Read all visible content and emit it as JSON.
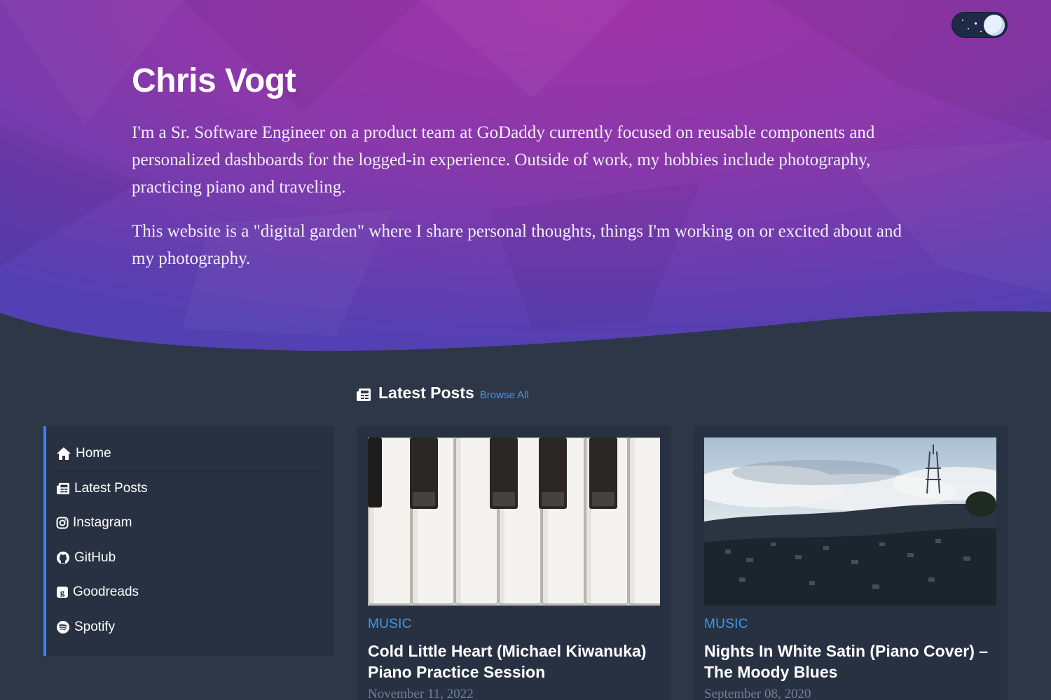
{
  "hero": {
    "name": "Chris Vogt",
    "paragraph1": "I'm a Sr. Software Engineer on a product team at GoDaddy currently focused on reusable components and personalized dashboards for the logged-in experience. Outside of work, my hobbies include photography, practicing piano and traveling.",
    "paragraph2": "This website is a \"digital garden\" where I share personal thoughts, things I'm working on or excited about and my photography."
  },
  "theme_toggle": {
    "icon": "moon-icon",
    "mode": "dark"
  },
  "latest_posts": {
    "title": "Latest Posts",
    "browse_label": "Browse All",
    "icon": "newspaper-icon"
  },
  "sidebar": {
    "items": [
      {
        "label": "Home",
        "icon": "home-icon"
      },
      {
        "label": "Latest Posts",
        "icon": "newspaper-icon"
      },
      {
        "label": "Instagram",
        "icon": "instagram-icon"
      },
      {
        "label": "GitHub",
        "icon": "github-icon"
      },
      {
        "label": "Goodreads",
        "icon": "goodreads-icon"
      },
      {
        "label": "Spotify",
        "icon": "spotify-icon"
      }
    ]
  },
  "posts": [
    {
      "category": "MUSIC",
      "title": "Cold Little Heart (Michael Kiwanuka) Piano Practice Session",
      "date": "November 11, 2022",
      "image": "piano-keys-photo"
    },
    {
      "category": "MUSIC",
      "title": "Nights In White Satin (Piano Cover) – The Moody Blues",
      "date": "September 08, 2020",
      "image": "city-hill-tower-photo"
    }
  ],
  "colors": {
    "page_bg": "#2d3748",
    "panel_bg": "#273142",
    "accent": "#4299e1",
    "sidebar_border": "#3b82f6",
    "hero_start": "#9b34a6",
    "hero_end": "#4b49b0",
    "date_text": "#718096"
  }
}
